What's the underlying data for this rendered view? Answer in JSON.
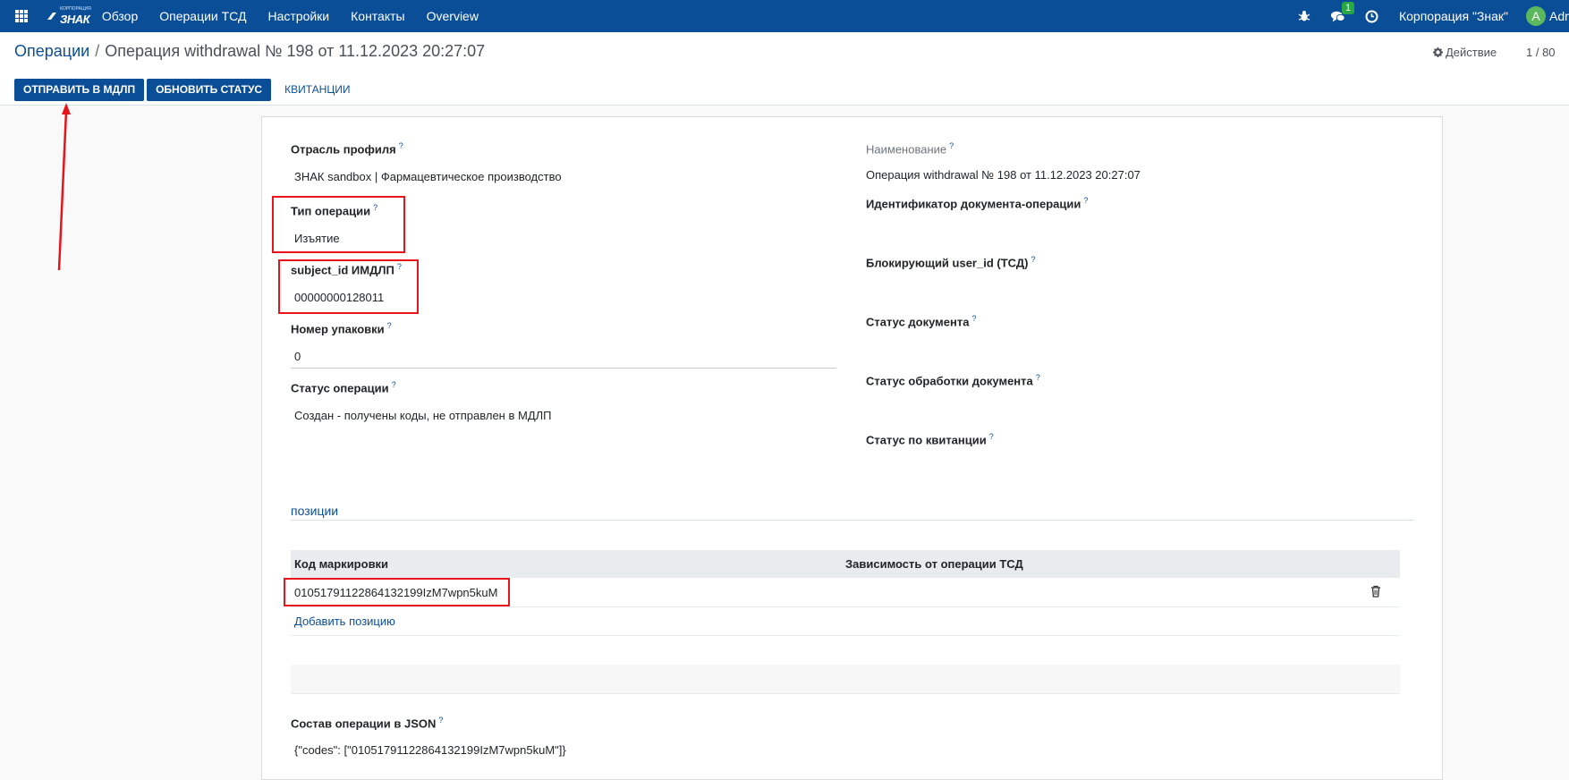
{
  "navbar": {
    "brand_top": "КОРПОРАЦИЯ",
    "brand_name": "ЗНАК",
    "menu": [
      "Обзор",
      "Операции ТСД",
      "Настройки",
      "Контакты",
      "Overview"
    ],
    "messages_badge": "1",
    "company": "Корпорация \"Знак\"",
    "avatar_letter": "A",
    "username": "Adm"
  },
  "control": {
    "breadcrumb_root": "Операции",
    "breadcrumb_separator": "/",
    "breadcrumb_current": "Операция withdrawal № 198 от 11.12.2023 20:27:07",
    "action_label": "Действие",
    "pager": "1 / 80",
    "buttons": {
      "send": "ОТПРАВИТЬ В МДЛП",
      "update": "ОБНОВИТЬ СТАТУС",
      "receipts": "КВИТАНЦИИ"
    }
  },
  "form": {
    "left": {
      "profile_industry_label": "Отрасль профиля",
      "profile_industry_value": "ЗНАК sandbox | Фармацевтическое производство",
      "op_type_label": "Тип операции",
      "op_type_value": "Изъятие",
      "subject_label": "subject_id ИМДЛП",
      "subject_value": "00000000128011",
      "pack_label": "Номер упаковки",
      "pack_value": "0",
      "op_status_label": "Статус операции",
      "op_status_value": "Создан - получены коды, не отправлен в МДЛП"
    },
    "right": {
      "name_label": "Наименование",
      "name_value": "Операция withdrawal № 198 от 11.12.2023 20:27:07",
      "doc_id_label": "Идентификатор документа-операции",
      "blocking_user_label": "Блокирующий user_id (ТСД)",
      "doc_status_label": "Статус документа",
      "doc_processing_label": "Статус обработки документа",
      "receipt_status_label": "Статус по квитанции"
    },
    "help_mark": "?",
    "positions_title": "позиции",
    "table": {
      "col_code": "Код маркировки",
      "col_dependency": "Зависимость от операции ТСД",
      "rows": [
        {
          "code": "01051791122864132199IzM7wpn5kuM"
        }
      ],
      "add_line": "Добавить позицию"
    },
    "json_label": "Состав операции в JSON",
    "json_value": "{\"codes\": [\"01051791122864132199IzM7wpn5kuM\"]}"
  }
}
